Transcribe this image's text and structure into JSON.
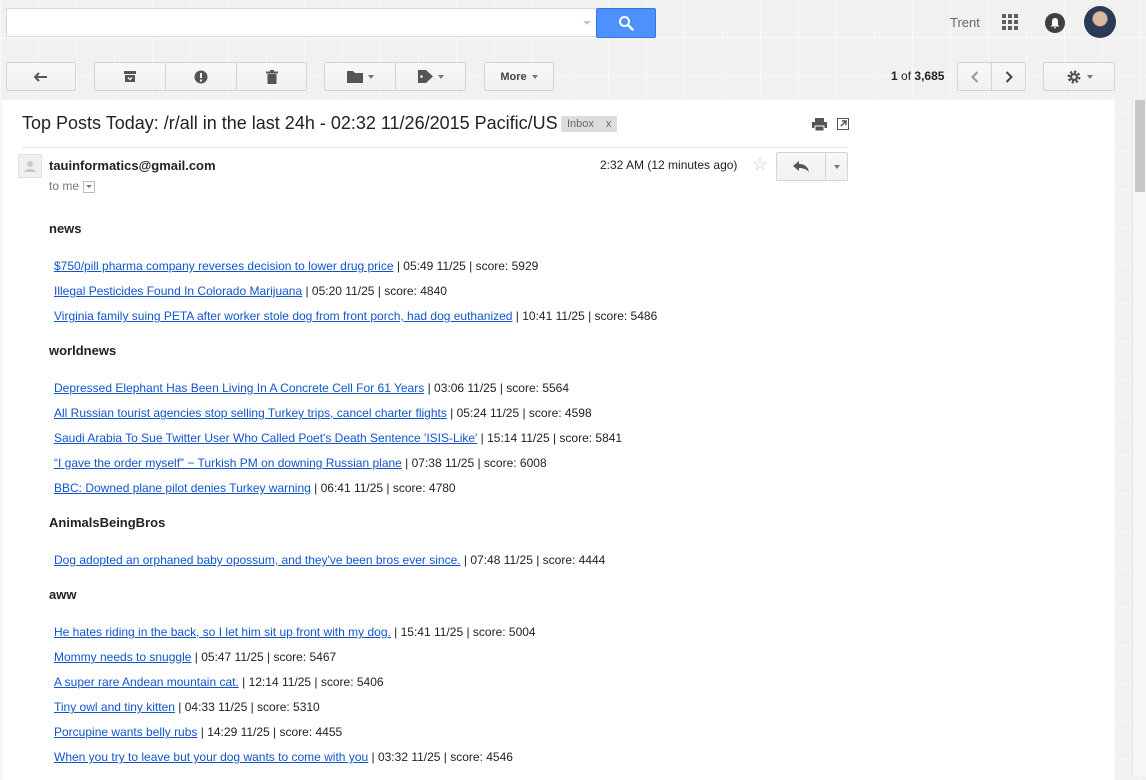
{
  "topbar": {
    "search_value": "",
    "user_name": "Trent"
  },
  "toolbar": {
    "more_label": "More",
    "pager_current": "1",
    "pager_of": "of",
    "pager_total": "3,685"
  },
  "message": {
    "subject": "Top Posts Today: /r/all in the last 24h - 02:32 11/26/2015 Pacific/US",
    "label": "Inbox",
    "label_remove": "x",
    "sender": "tauinformatics@gmail.com",
    "recipient": "to me",
    "time": "2:32 AM (12 minutes ago)"
  },
  "sections": [
    {
      "title": "news",
      "posts": [
        {
          "title": "$750/pill pharma company reverses decision to lower drug price",
          "meta": " | 05:49 11/25 | score: 5929"
        },
        {
          "title": "Illegal Pesticides Found In Colorado Marijuana",
          "meta": " | 05:20 11/25 | score: 4840"
        },
        {
          "title": "Virginia family suing PETA after worker stole dog from front porch, had dog euthanized",
          "meta": " | 10:41 11/25 | score: 5486"
        }
      ]
    },
    {
      "title": "worldnews",
      "posts": [
        {
          "title": "Depressed Elephant Has Been Living In A Concrete Cell For 61 Years",
          "meta": " | 03:06 11/25 | score: 5564"
        },
        {
          "title": "All Russian tourist agencies stop selling Turkey trips, cancel charter flights",
          "meta": " | 05:24 11/25 | score: 4598"
        },
        {
          "title": "Saudi Arabia To Sue Twitter User Who Called Poet's Death Sentence 'ISIS-Like'",
          "meta": " | 15:14 11/25 | score: 5841"
        },
        {
          "title": "“I gave the order myself” − Turkish PM on downing Russian plane",
          "meta": " | 07:38 11/25 | score: 6008"
        },
        {
          "title": "BBC: Downed plane pilot denies Turkey warning",
          "meta": " | 06:41 11/25 | score: 4780"
        }
      ]
    },
    {
      "title": "AnimalsBeingBros",
      "posts": [
        {
          "title": "Dog adopted an orphaned baby opossum, and they've been bros ever since.",
          "meta": " | 07:48 11/25 | score: 4444"
        }
      ]
    },
    {
      "title": "aww",
      "posts": [
        {
          "title": "He hates riding in the back, so I let him sit up front with my dog.",
          "meta": " | 15:41 11/25 | score: 5004"
        },
        {
          "title": "Mommy needs to snuggle",
          "meta": " | 05:47 11/25 | score: 5467"
        },
        {
          "title": "A super rare Andean mountain cat.",
          "meta": " | 12:14 11/25 | score: 5406"
        },
        {
          "title": "Tiny owl and tiny kitten",
          "meta": " | 04:33 11/25 | score: 5310"
        },
        {
          "title": "Porcupine wants belly rubs",
          "meta": " | 14:29 11/25 | score: 4455"
        },
        {
          "title": "When you try to leave but your dog wants to come with you",
          "meta": " | 03:32 11/25 | score: 4546"
        }
      ]
    }
  ]
}
